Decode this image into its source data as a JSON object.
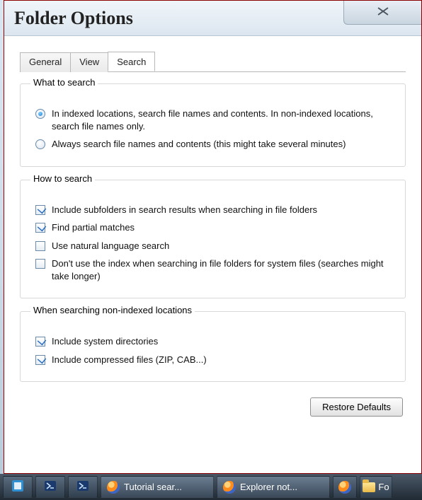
{
  "title": "Folder Options",
  "tabs": [
    {
      "label": "General",
      "active": false
    },
    {
      "label": "View",
      "active": false
    },
    {
      "label": "Search",
      "active": true
    }
  ],
  "groups": {
    "what": {
      "legend": "What to search",
      "options": [
        {
          "label": "In indexed locations, search file names and contents. In non-indexed locations, search file names only.",
          "checked": true
        },
        {
          "label": "Always search file names and contents (this might take several minutes)",
          "checked": false
        }
      ]
    },
    "how": {
      "legend": "How to search",
      "options": [
        {
          "label": "Include subfolders in search results when searching in file folders",
          "checked": true
        },
        {
          "label": "Find partial matches",
          "checked": true
        },
        {
          "label": "Use natural language search",
          "checked": false
        },
        {
          "label": "Don't use the index when searching in file folders for system files (searches might take longer)",
          "checked": false
        }
      ]
    },
    "nonindexed": {
      "legend": "When searching non-indexed locations",
      "options": [
        {
          "label": "Include system directories",
          "checked": true
        },
        {
          "label": "Include compressed files (ZIP, CAB...)",
          "checked": true
        }
      ]
    }
  },
  "buttons": {
    "restore_defaults": "Restore Defaults"
  },
  "taskbar": {
    "items": [
      {
        "kind": "icon",
        "name": "app-icon-1"
      },
      {
        "kind": "icon",
        "name": "powershell-icon"
      },
      {
        "kind": "icon",
        "name": "powershell-icon-2"
      },
      {
        "kind": "window",
        "name": "firefox",
        "label": "Tutorial sear..."
      },
      {
        "kind": "window",
        "name": "firefox",
        "label": "Explorer not..."
      },
      {
        "kind": "icon",
        "name": "firefox-icon"
      },
      {
        "kind": "icon",
        "name": "folder-icon",
        "label": "Fo"
      }
    ]
  }
}
